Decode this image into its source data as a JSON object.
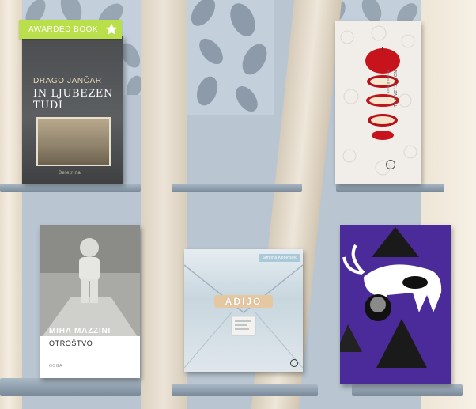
{
  "badge": {
    "label": "AWARDED BOOK",
    "icon": "star-icon"
  },
  "books": {
    "b1": {
      "author": "DRAGO JANČAR",
      "title_line1": "IN LJUBEZEN",
      "title_line2": "TUDI",
      "publisher": "Beletrina"
    },
    "b2": {
      "title": "NOČ JE, ZASPAL",
      "author": "Andrej Blatnik"
    },
    "b4": {
      "author": "MIHA MAZZINI",
      "title": "OTROŠTVO",
      "publisher": "GOGA"
    },
    "b5": {
      "author": "Simona Kopinšek",
      "title": "ADIJO"
    }
  },
  "colors": {
    "badge": "#b9e04a",
    "shelf": "#8d9dab",
    "wall": "#b9c6d2",
    "purple_cover": "#4b2b9a"
  }
}
